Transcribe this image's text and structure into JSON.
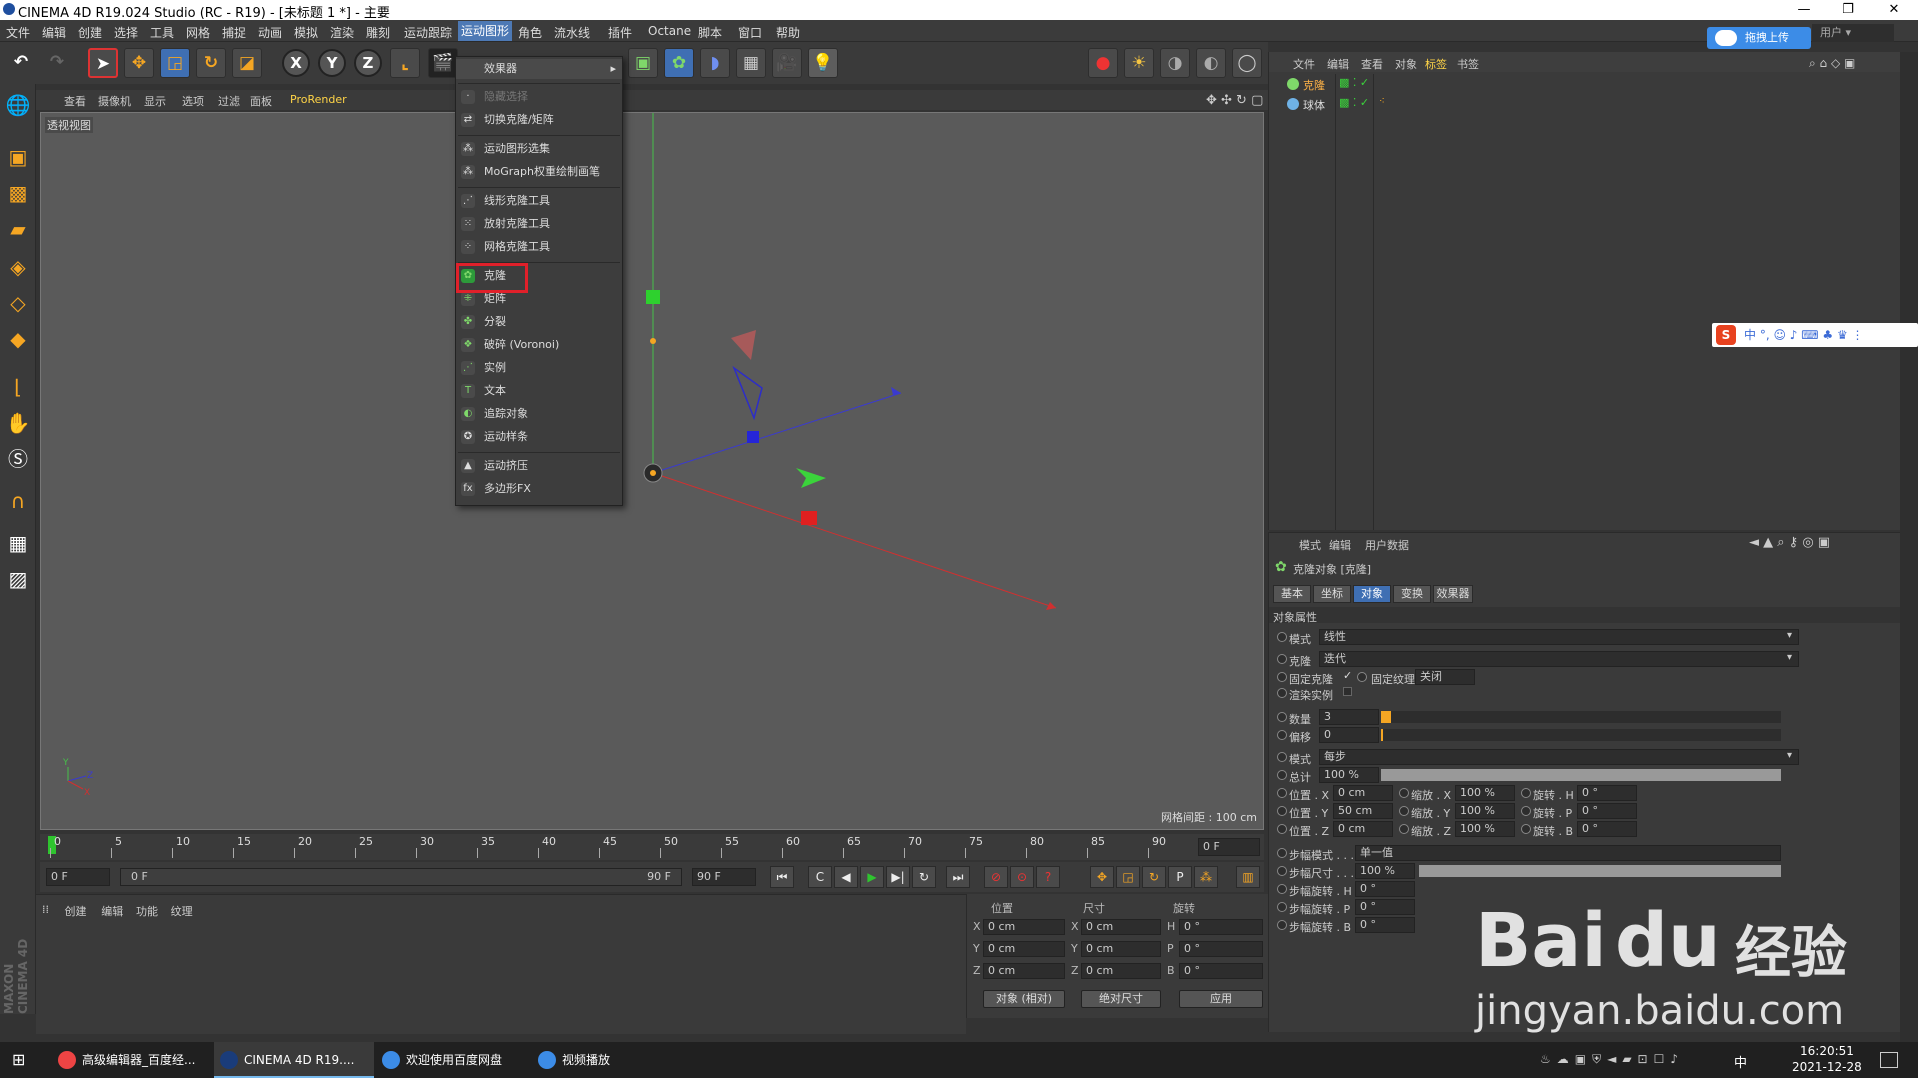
{
  "window": {
    "title": "CINEMA 4D R19.024 Studio (RC - R19) - [未标题 1 *] - 主要"
  },
  "menubar": [
    "文件",
    "编辑",
    "创建",
    "选择",
    "工具",
    "网格",
    "捕捉",
    "动画",
    "模拟",
    "渲染",
    "雕刻",
    "运动跟踪",
    "运动图形",
    "角色",
    "流水线",
    "插件",
    "Octane",
    "脚本",
    "窗口",
    "帮助"
  ],
  "menubar_active": "运动图形",
  "toolbar": {
    "axes": [
      "X",
      "Y",
      "Z"
    ]
  },
  "viewport": {
    "tabs": [
      "查看",
      "摄像机",
      "显示",
      "选项",
      "过滤",
      "面板",
      "ProRender"
    ],
    "label": "透视视图",
    "grid_info": "网格间距 : 100 cm"
  },
  "dropdown": {
    "header": "效果器",
    "items": [
      {
        "label": "隐藏选择",
        "disabled": true,
        "sep_before": true
      },
      {
        "label": "切换克隆/矩阵"
      },
      {
        "label": "运动图形选集",
        "sep_before": true
      },
      {
        "label": "MoGraph权重绘制画笔"
      },
      {
        "label": "线形克隆工具",
        "sep_before": true
      },
      {
        "label": "放射克隆工具"
      },
      {
        "label": "网格克隆工具"
      },
      {
        "label": "克隆",
        "sep_before": true,
        "highlight": true
      },
      {
        "label": "矩阵"
      },
      {
        "label": "分裂"
      },
      {
        "label": "破碎 (Voronoi)"
      },
      {
        "label": "实例"
      },
      {
        "label": "文本"
      },
      {
        "label": "追踪对象"
      },
      {
        "label": "运动样条"
      },
      {
        "label": "运动挤压",
        "sep_before": true
      },
      {
        "label": "多边形FX"
      }
    ]
  },
  "timeline": {
    "ticks": [
      "0",
      "5",
      "10",
      "15",
      "20",
      "25",
      "30",
      "35",
      "40",
      "45",
      "50",
      "55",
      "60",
      "65",
      "70",
      "75",
      "80",
      "85",
      "90"
    ],
    "current_frame": "0 F",
    "start": "0 F",
    "range_start": "0 F",
    "range_end": "90 F",
    "end": "90 F"
  },
  "material_panel": {
    "tabs": [
      "创建",
      "编辑",
      "功能",
      "纹理"
    ]
  },
  "coord_panel": {
    "headers": [
      "位置",
      "尺寸",
      "旋转"
    ],
    "rows": [
      {
        "axis": "X",
        "pos": "0 cm",
        "size_axis": "X",
        "size": "0 cm",
        "rot_axis": "H",
        "rot": "0 °"
      },
      {
        "axis": "Y",
        "pos": "0 cm",
        "size_axis": "Y",
        "size": "0 cm",
        "rot_axis": "P",
        "rot": "0 °"
      },
      {
        "axis": "Z",
        "pos": "0 cm",
        "size_axis": "Z",
        "size": "0 cm",
        "rot_axis": "B",
        "rot": "0 °"
      }
    ],
    "mode": "对象 (相对)",
    "size_mode": "绝对尺寸",
    "apply": "应用"
  },
  "object_manager": {
    "tabs": [
      "文件",
      "编辑",
      "查看",
      "对象",
      "标签",
      "书签"
    ],
    "objects": [
      {
        "name": "克隆",
        "color": "#7fd86a"
      },
      {
        "name": "球体",
        "color": "#6fb2e6"
      }
    ]
  },
  "attribute_manager": {
    "tabs": [
      "模式",
      "编辑",
      "用户数据"
    ],
    "object_title": "克隆对象 [克隆]",
    "subtabs": [
      "基本",
      "坐标",
      "对象",
      "变换",
      "效果器"
    ],
    "active_subtab": "对象",
    "section": "对象属性",
    "mode_label": "模式",
    "mode_value": "线性",
    "clone_label": "克隆",
    "clone_value": "迭代",
    "fix_clone": "固定克隆",
    "fix_texture": "固定纹理",
    "fix_texture_value": "关闭",
    "render_instances": "渲染实例",
    "count_label": "数量",
    "count_value": "3",
    "offset_label": "偏移",
    "offset_value": "0",
    "mode2_label": "模式",
    "mode2_value": "每步",
    "total_label": "总计",
    "total_value": "100 %",
    "pos": [
      {
        "label": "位置 . X",
        "value": "0 cm",
        "scale_label": "缩放 . X",
        "scale": "100 %",
        "rot_label": "旋转 . H",
        "rot": "0 °"
      },
      {
        "label": "位置 . Y",
        "value": "50 cm",
        "scale_label": "缩放 . Y",
        "scale": "100 %",
        "rot_label": "旋转 . P",
        "rot": "0 °"
      },
      {
        "label": "位置 . Z",
        "value": "0 cm",
        "scale_label": "缩放 . Z",
        "scale": "100 %",
        "rot_label": "旋转 . B",
        "rot": "0 °"
      }
    ],
    "step_mode_label": "步幅模式 . . .",
    "step_mode_value": "单一值",
    "step_size_label": "步幅尺寸 . . .",
    "step_size_value": "100 %",
    "step_rot": [
      {
        "label": "步幅旋转 . H",
        "value": "0 °"
      },
      {
        "label": "步幅旋转 . P",
        "value": "0 °"
      },
      {
        "label": "步幅旋转 . B",
        "value": "0 °"
      }
    ]
  },
  "overlays": {
    "baidu_upload": "拖拽上传",
    "user_label": "用户",
    "sogou": "中 °, ☺ ♪ ⌨ ♣ ♛ ⋮"
  },
  "taskbar": {
    "items": [
      "高级编辑器_百度经...",
      "CINEMA 4D R19....",
      "欢迎使用百度网盘",
      "视频播放"
    ],
    "time": "16:20:51",
    "date": "2021-12-28",
    "ime": "中"
  },
  "watermark": {
    "brand": "Bai",
    "paw": "du",
    "cn": "经验",
    "url": "jingyan.baidu.com"
  },
  "maxon_logo": "MAXON CINEMA 4D"
}
